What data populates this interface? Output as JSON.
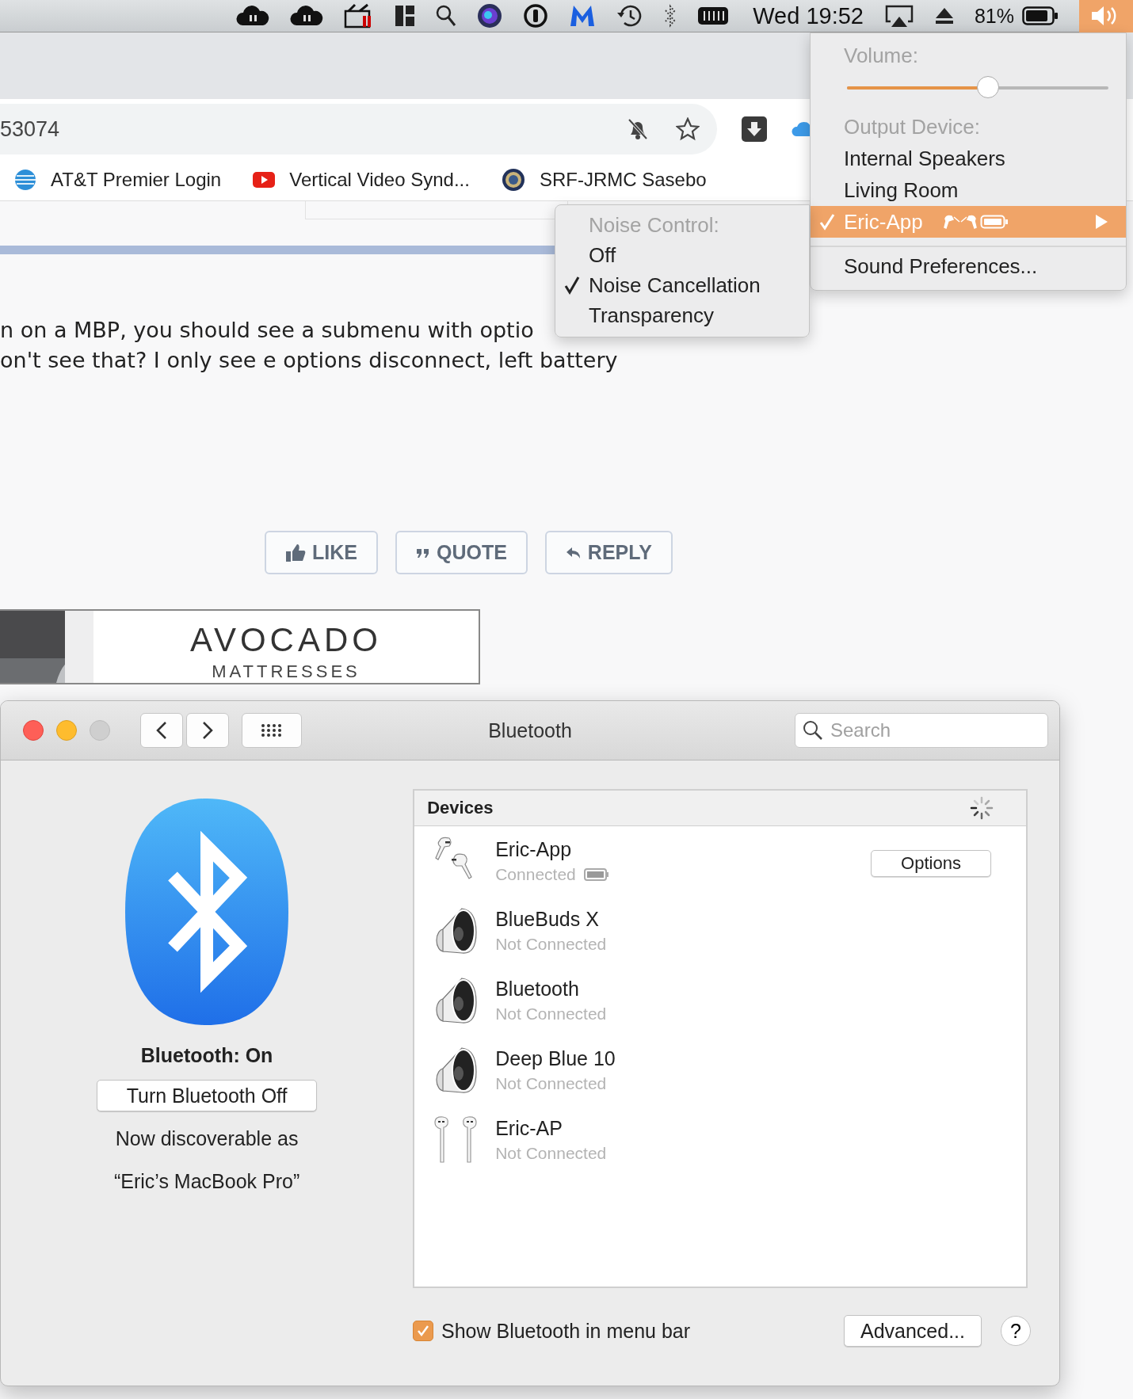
{
  "menubar": {
    "clock": "Wed 19:52",
    "battery_percent": "81%"
  },
  "browser": {
    "address": "53074",
    "bookmarks": [
      {
        "label": "AT&T Premier Login",
        "kind": "globe"
      },
      {
        "label": "Vertical Video Synd...",
        "kind": "video"
      },
      {
        "label": "SRF-JRMC Sasebo",
        "kind": "seal"
      }
    ]
  },
  "post": {
    "lines": [
      "n on a MBP, you should see a submenu with optio",
      "on't see that? I only see e options disconnect, left battery"
    ],
    "actions": [
      {
        "label": "LIKE",
        "kind": "like"
      },
      {
        "label": "QUOTE",
        "kind": "quote"
      },
      {
        "label": "REPLY",
        "kind": "reply"
      }
    ]
  },
  "ad": {
    "brand": "AVOCADO",
    "tagline": "MATTRESSES"
  },
  "volume_menu": {
    "volume_label": "Volume:",
    "level": 0.54,
    "output_label": "Output Device:",
    "devices": [
      {
        "name": "Internal Speakers",
        "selected": false,
        "highlighted": false
      },
      {
        "name": "Living Room",
        "selected": false,
        "highlighted": false
      },
      {
        "name": "Eric-App",
        "selected": true,
        "highlighted": true,
        "kind": "airpods"
      }
    ],
    "footer": "Sound Preferences..."
  },
  "noise_menu": {
    "header": "Noise Control:",
    "options": [
      {
        "label": "Off",
        "selected": false
      },
      {
        "label": "Noise Cancellation",
        "selected": true
      },
      {
        "label": "Transparency",
        "selected": false
      }
    ]
  },
  "bluetooth_window": {
    "title": "Bluetooth",
    "search_placeholder": "Search",
    "status": "Bluetooth: On",
    "toggle_button": "Turn Bluetooth Off",
    "discoverable_label": "Now discoverable as",
    "discoverable_name": "“Eric’s MacBook Pro”",
    "devices_header": "Devices",
    "devices": [
      {
        "name": "Eric-App",
        "status": "Connected",
        "kind": "airpods-pro",
        "action": "Options"
      },
      {
        "name": "BlueBuds X",
        "status": "Not Connected",
        "kind": "speaker"
      },
      {
        "name": "Bluetooth",
        "status": "Not Connected",
        "kind": "speaker"
      },
      {
        "name": "Deep Blue 10",
        "status": "Not Connected",
        "kind": "speaker"
      },
      {
        "name": "Eric-AP",
        "status": "Not Connected",
        "kind": "airpods"
      }
    ],
    "show_in_menu_bar": {
      "label": "Show Bluetooth in menu bar",
      "checked": true
    },
    "advanced_button": "Advanced...",
    "help_button": "?"
  }
}
